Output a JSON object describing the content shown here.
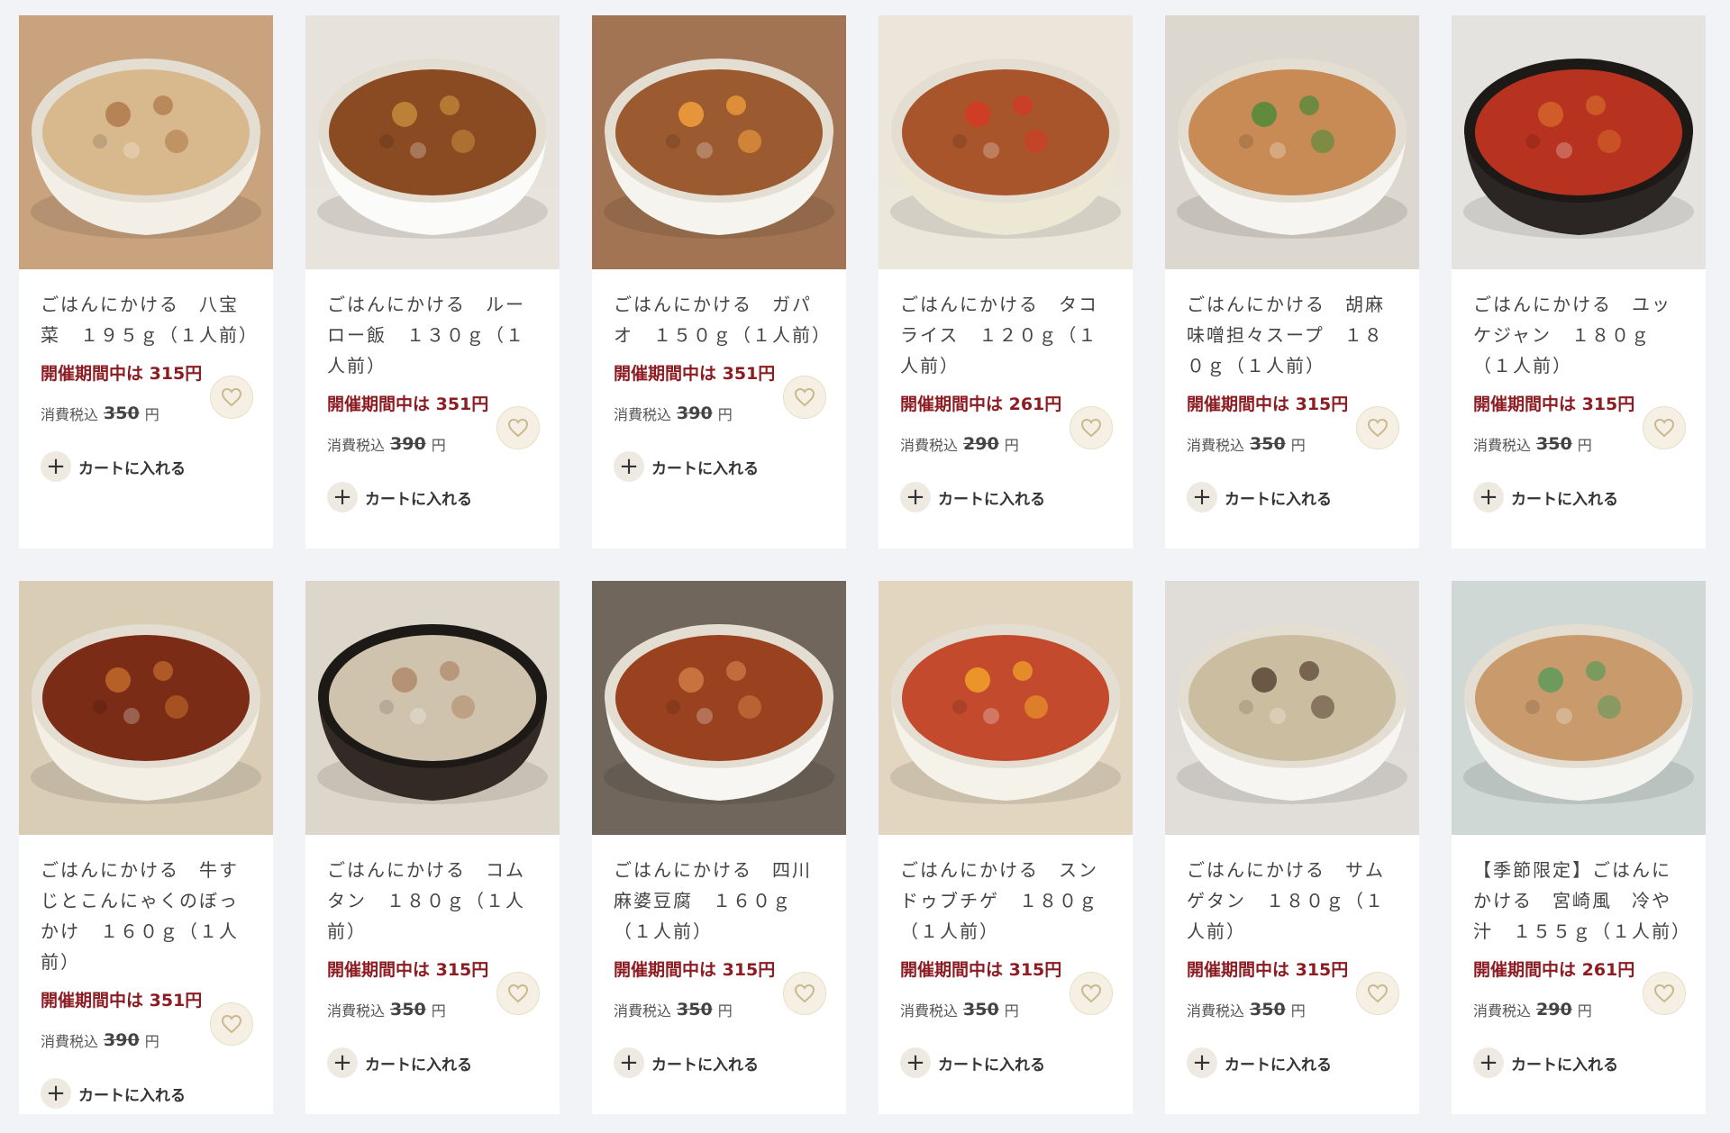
{
  "labels": {
    "tax": "消費税込",
    "yen": "円",
    "cart": "カートに入れる"
  },
  "colors": {
    "sale": "#8c1c22",
    "background": "#f1f3f6",
    "fav_bg": "#f5f0e3"
  },
  "products": [
    {
      "name": "ごはんにかける　八宝菜　１９５ｇ（１人前）",
      "sale": "開催期間中は 315円",
      "orig": "350",
      "bg": "#c9a27e",
      "bowl": "#f4efe6",
      "food": "#d8b98d",
      "accent": "#b07a4a"
    },
    {
      "name": "ごはんにかける　ルーロー飯　１３０ｇ（１人前）",
      "sale": "開催期間中は 351円",
      "orig": "390",
      "bg": "#e7e3dc",
      "bowl": "#fbfbf9",
      "food": "#8a4a22",
      "accent": "#c48a3a"
    },
    {
      "name": "ごはんにかける　ガパオ　１５０ｇ（１人前）",
      "sale": "開催期間中は 351円",
      "orig": "390",
      "bg": "#a37453",
      "bowl": "#f6f4ef",
      "food": "#9b5a30",
      "accent": "#f4a03c"
    },
    {
      "name": "ごはんにかける　タコライス　１２０ｇ（１人前）",
      "sale": "開催期間中は 261円",
      "orig": "290",
      "bg": "#ece6da",
      "bowl": "#ece8d3",
      "food": "#a8552c",
      "accent": "#d63a24"
    },
    {
      "name": "ごはんにかける　胡麻味噌担々スープ　１８０ｇ（１人前）",
      "sale": "開催期間中は 315円",
      "orig": "350",
      "bg": "#dcd7cf",
      "bowl": "#f7f5f1",
      "food": "#c98b55",
      "accent": "#4f8a3a"
    },
    {
      "name": "ごはんにかける　ユッケジャン　１８０ｇ（１人前）",
      "sale": "開催期間中は 315円",
      "orig": "350",
      "bg": "#e4e3df",
      "bowl": "#2b2623",
      "food": "#b8331f",
      "accent": "#d4652c"
    },
    {
      "name": "ごはんにかける　牛すじとこんにゃくのぼっかけ　１６０ｇ（１人前）",
      "sale": "開催期間中は 351円",
      "orig": "390",
      "bg": "#d9cdb6",
      "bowl": "#f3efe5",
      "food": "#7a2c16",
      "accent": "#c16a2c"
    },
    {
      "name": "ごはんにかける　コムタン　１８０ｇ（１人前）",
      "sale": "開催期間中は 315円",
      "orig": "350",
      "bg": "#ddd6ca",
      "bowl": "#332a25",
      "food": "#cfc3ae",
      "accent": "#b08a68"
    },
    {
      "name": "ごはんにかける　四川麻婆豆腐　１６０ｇ（１人前）",
      "sale": "開催期間中は 315円",
      "orig": "350",
      "bg": "#70665c",
      "bowl": "#f7f6f2",
      "food": "#9a4220",
      "accent": "#cf7a45"
    },
    {
      "name": "ごはんにかける　スンドゥブチゲ　１８０ｇ（１人前）",
      "sale": "開催期間中は 315円",
      "orig": "350",
      "bg": "#e3d6c0",
      "bowl": "#f5f2ea",
      "food": "#c34a2c",
      "accent": "#f2a12a"
    },
    {
      "name": "ごはんにかける　サムゲタン　１８０ｇ（１人前）",
      "sale": "開催期間中は 315円",
      "orig": "350",
      "bg": "#e0ddd8",
      "bowl": "#f6f5f1",
      "food": "#cbbd9f",
      "accent": "#5a4535"
    },
    {
      "name": "【季節限定】ごはんにかける　宮崎風　冷や汁　１５５ｇ（１人前）",
      "sale": "開催期間中は 261円",
      "orig": "290",
      "bg": "#cfd8d4",
      "bowl": "#f4f4f1",
      "food": "#c99a6c",
      "accent": "#5f9a5a"
    }
  ]
}
